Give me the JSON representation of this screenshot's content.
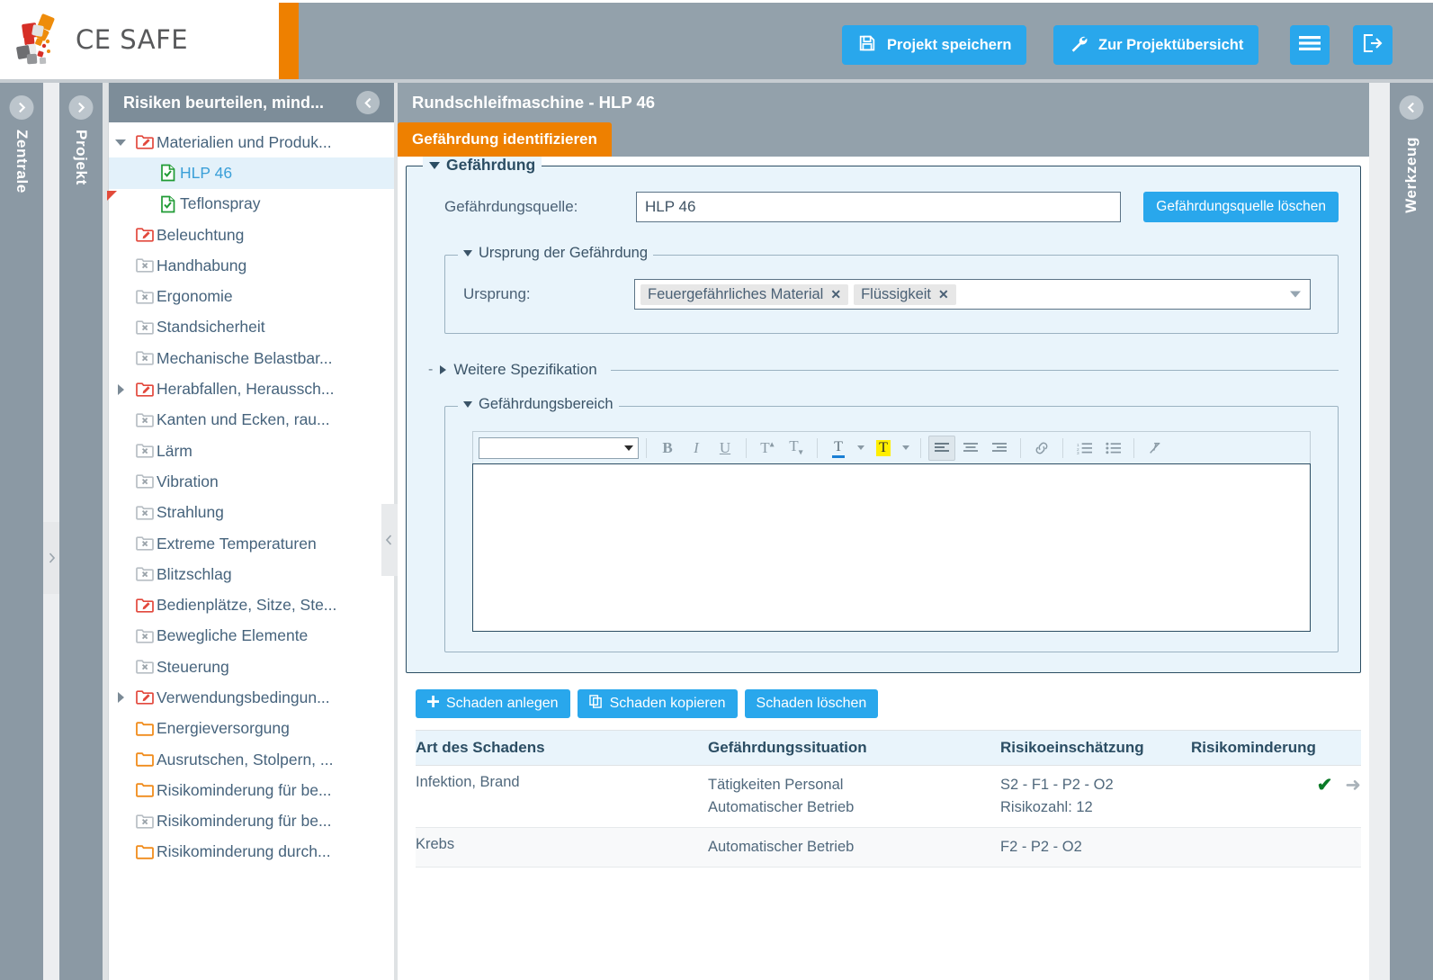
{
  "brand": {
    "name": "CE SAFE"
  },
  "header": {
    "save_label": "Projekt speichern",
    "overview_label": "Zur Projektübersicht",
    "menu_icon": "hamburger-icon",
    "logout_icon": "logout-icon",
    "accent_orange": "#ee8000",
    "accent_blue": "#29a7ec",
    "gray": "#93a1ab"
  },
  "left_rails": [
    {
      "label": "Zentrale",
      "arrow": "chevron-right"
    },
    {
      "label": "Projekt",
      "arrow": "chevron-right"
    }
  ],
  "right_rail": {
    "label": "Werkzeug",
    "arrow": "chevron-left"
  },
  "tree": {
    "title": "Risiken beurteilen, mind...",
    "collapse_icon": "chevron-left-circle",
    "items": [
      {
        "label": "Materialien und Produk...",
        "icon": "folder-edit-red",
        "indent": 1,
        "twisty": "down",
        "selected": false,
        "flag": false
      },
      {
        "label": "HLP 46",
        "icon": "doc-check-green",
        "indent": 2,
        "twisty": "none",
        "selected": true,
        "flag": false
      },
      {
        "label": "Teflonspray",
        "icon": "doc-check-green",
        "indent": 2,
        "twisty": "none",
        "selected": false,
        "flag": true
      },
      {
        "label": "Beleuchtung",
        "icon": "folder-edit-red",
        "indent": 1,
        "twisty": "none",
        "selected": false,
        "flag": false
      },
      {
        "label": "Handhabung",
        "icon": "folder-x-gray",
        "indent": 1,
        "twisty": "none",
        "selected": false,
        "flag": false
      },
      {
        "label": "Ergonomie",
        "icon": "folder-x-gray",
        "indent": 1,
        "twisty": "none",
        "selected": false,
        "flag": false
      },
      {
        "label": "Standsicherheit",
        "icon": "folder-x-gray",
        "indent": 1,
        "twisty": "none",
        "selected": false,
        "flag": false
      },
      {
        "label": "Mechanische Belastbar...",
        "icon": "folder-x-gray",
        "indent": 1,
        "twisty": "none",
        "selected": false,
        "flag": false
      },
      {
        "label": "Herabfallen, Heraussch...",
        "icon": "folder-edit-red",
        "indent": 1,
        "twisty": "right",
        "selected": false,
        "flag": false
      },
      {
        "label": "Kanten und Ecken, rau...",
        "icon": "folder-x-gray",
        "indent": 1,
        "twisty": "none",
        "selected": false,
        "flag": false
      },
      {
        "label": "Lärm",
        "icon": "folder-x-gray",
        "indent": 1,
        "twisty": "none",
        "selected": false,
        "flag": false
      },
      {
        "label": "Vibration",
        "icon": "folder-x-gray",
        "indent": 1,
        "twisty": "none",
        "selected": false,
        "flag": false
      },
      {
        "label": "Strahlung",
        "icon": "folder-x-gray",
        "indent": 1,
        "twisty": "none",
        "selected": false,
        "flag": false
      },
      {
        "label": "Extreme Temperaturen",
        "icon": "folder-x-gray",
        "indent": 1,
        "twisty": "none",
        "selected": false,
        "flag": false
      },
      {
        "label": "Blitzschlag",
        "icon": "folder-x-gray",
        "indent": 1,
        "twisty": "none",
        "selected": false,
        "flag": false
      },
      {
        "label": "Bedienplätze, Sitze, Ste...",
        "icon": "folder-edit-red",
        "indent": 1,
        "twisty": "none",
        "selected": false,
        "flag": false
      },
      {
        "label": "Bewegliche Elemente",
        "icon": "folder-x-gray",
        "indent": 1,
        "twisty": "none",
        "selected": false,
        "flag": false
      },
      {
        "label": "Steuerung",
        "icon": "folder-x-gray",
        "indent": 1,
        "twisty": "none",
        "selected": false,
        "flag": false
      },
      {
        "label": "Verwendungsbedingun...",
        "icon": "folder-edit-red",
        "indent": 1,
        "twisty": "right",
        "selected": false,
        "flag": false
      },
      {
        "label": "Energieversorgung",
        "icon": "folder-orange",
        "indent": 1,
        "twisty": "none",
        "selected": false,
        "flag": false
      },
      {
        "label": "Ausrutschen, Stolpern, ...",
        "icon": "folder-orange",
        "indent": 1,
        "twisty": "none",
        "selected": false,
        "flag": false
      },
      {
        "label": "Risikominderung für be...",
        "icon": "folder-orange",
        "indent": 1,
        "twisty": "none",
        "selected": false,
        "flag": false
      },
      {
        "label": "Risikominderung für be...",
        "icon": "folder-x-gray",
        "indent": 1,
        "twisty": "none",
        "selected": false,
        "flag": false
      },
      {
        "label": "Risikominderung durch...",
        "icon": "folder-orange",
        "indent": 1,
        "twisty": "none",
        "selected": false,
        "flag": false
      }
    ]
  },
  "main": {
    "title": "Rundschleifmaschine - HLP 46",
    "active_tab": "Gefährdung identifizieren",
    "gefaehrdung": {
      "legend": "Gefährdung",
      "source_label": "Gefährdungsquelle:",
      "source_value": "HLP 46",
      "delete_button": "Gefährdungsquelle löschen",
      "origin_legend": "Ursprung der Gefährdung",
      "origin_label": "Ursprung:",
      "origin_tags": [
        "Flüssigkeit",
        "Feuergefährliches Material"
      ]
    },
    "weitere_spezifikation": {
      "dash": "-",
      "label": "Weitere Spezifikation"
    },
    "gefaehrdungsbereich": {
      "legend": "Gefährdungsbereich",
      "editor_value": "",
      "style_select_value": "",
      "toolbar": [
        {
          "name": "bold-icon",
          "glyph": "B"
        },
        {
          "name": "italic-icon",
          "glyph": "I"
        },
        {
          "name": "underline-icon",
          "glyph": "U"
        },
        {
          "name": "superscript-icon",
          "glyph": "T"
        },
        {
          "name": "subscript-icon",
          "glyph": "T"
        },
        {
          "name": "text-color-icon",
          "glyph": "T"
        },
        {
          "name": "highlight-color-icon",
          "glyph": "T"
        },
        {
          "name": "align-left-icon",
          "glyph": "≡"
        },
        {
          "name": "align-center-icon",
          "glyph": "≡"
        },
        {
          "name": "align-right-icon",
          "glyph": "≡"
        },
        {
          "name": "link-icon",
          "glyph": "🔗"
        },
        {
          "name": "ordered-list-icon",
          "glyph": "≔"
        },
        {
          "name": "bullet-list-icon",
          "glyph": "≔"
        },
        {
          "name": "clear-format-icon",
          "glyph": "✒"
        }
      ]
    }
  },
  "damage": {
    "buttons": [
      {
        "name": "create-damage-button",
        "label": "Schaden anlegen",
        "icon": "plus-icon"
      },
      {
        "name": "copy-damage-button",
        "label": "Schaden kopieren",
        "icon": "copy-icon"
      },
      {
        "name": "delete-damage-button",
        "label": "Schaden löschen",
        "icon": "none"
      }
    ],
    "columns": [
      "Art des Schadens",
      "Gefährdungssituation",
      "Risikoeinschätzung",
      "Risikominderung"
    ],
    "rows": [
      {
        "art": "Infektion, Brand",
        "situation": [
          "Tätigkeiten Personal",
          "Automatischer Betrieb"
        ],
        "risiko": [
          "S2 - F1 - P2 - O2",
          "Risikozahl: 12"
        ],
        "minderung_check": "✔",
        "minderung_arrow": "➜"
      },
      {
        "art": "Krebs",
        "situation": [
          "Automatischer Betrieb"
        ],
        "risiko": [
          "F2 - P2 - O2"
        ],
        "minderung_check": "",
        "minderung_arrow": ""
      }
    ]
  }
}
